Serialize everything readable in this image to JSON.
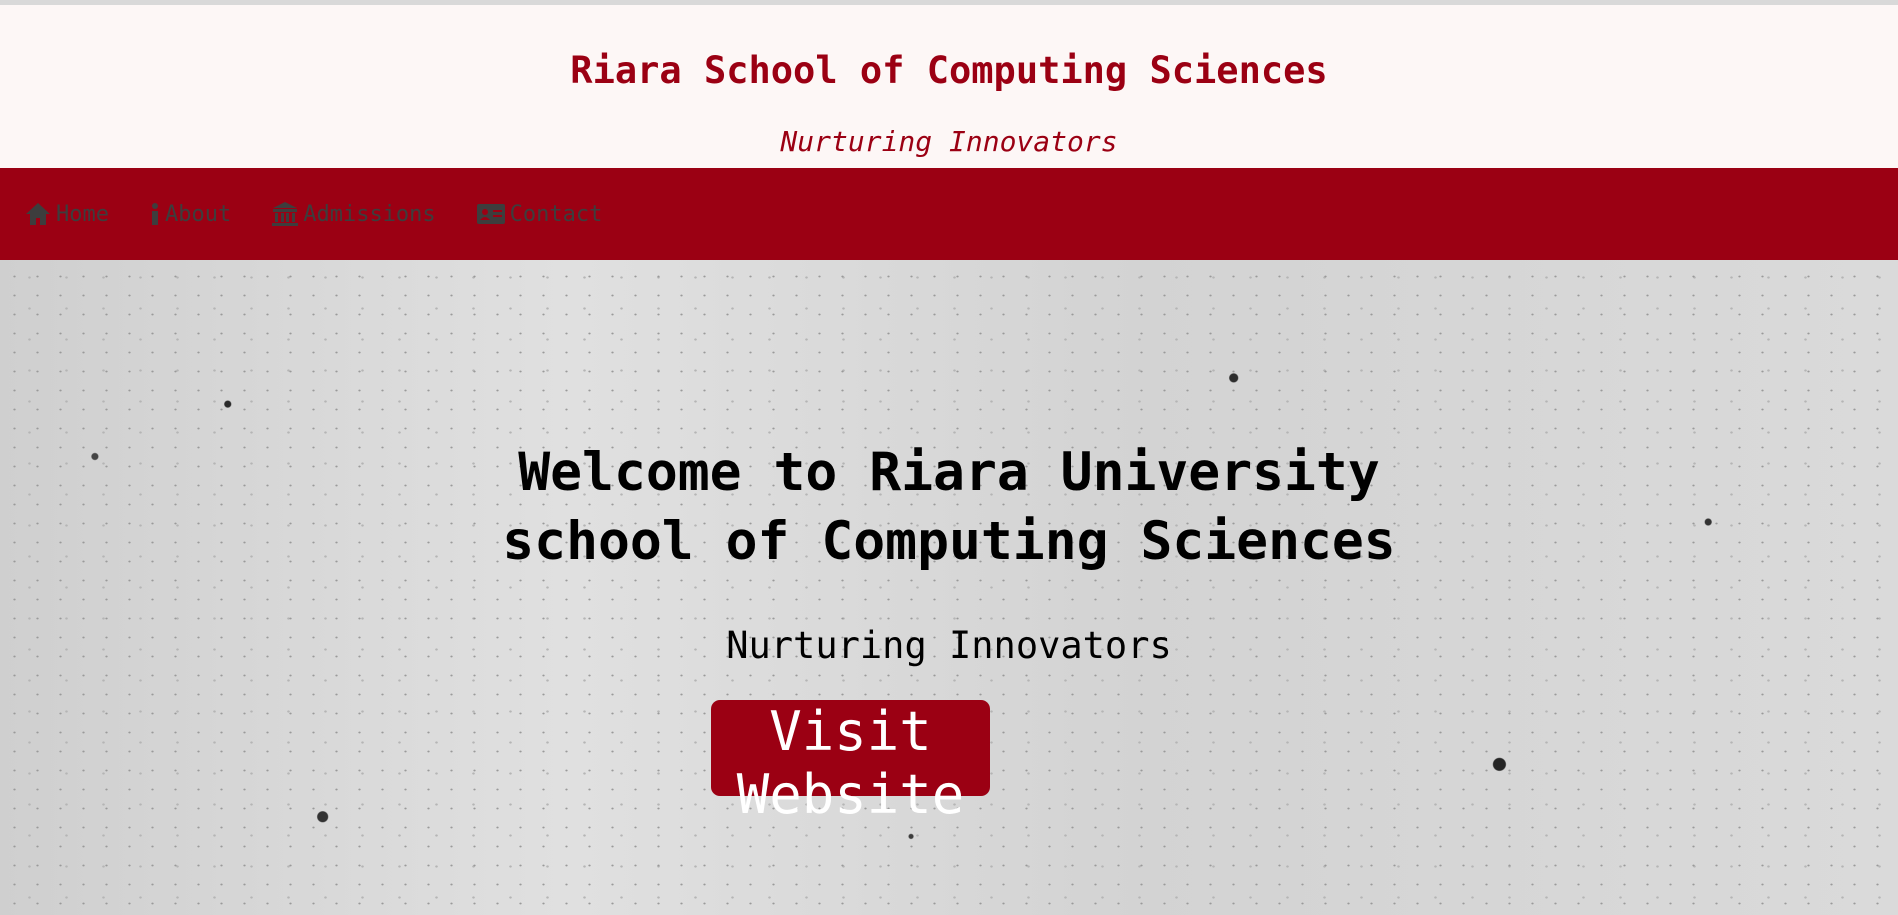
{
  "header": {
    "title": "Riara School of Computing Sciences",
    "tagline": "Nurturing Innovators"
  },
  "nav": {
    "items": [
      {
        "label": "Home",
        "icon": "home-icon"
      },
      {
        "label": "About",
        "icon": "info-icon"
      },
      {
        "label": "Admissions",
        "icon": "institution-icon"
      },
      {
        "label": "Contact",
        "icon": "contact-card-icon"
      }
    ]
  },
  "hero": {
    "title_line1": "Welcome to Riara University",
    "title_line2": "school of Computing Sciences",
    "subtitle": "Nurturing Innovators",
    "button_label": "Visit Website"
  },
  "colors": {
    "brand": "#9b0013",
    "header_bg": "#fdf7f6",
    "nav_text": "#3d3d3d",
    "button_text": "#ffffff"
  }
}
